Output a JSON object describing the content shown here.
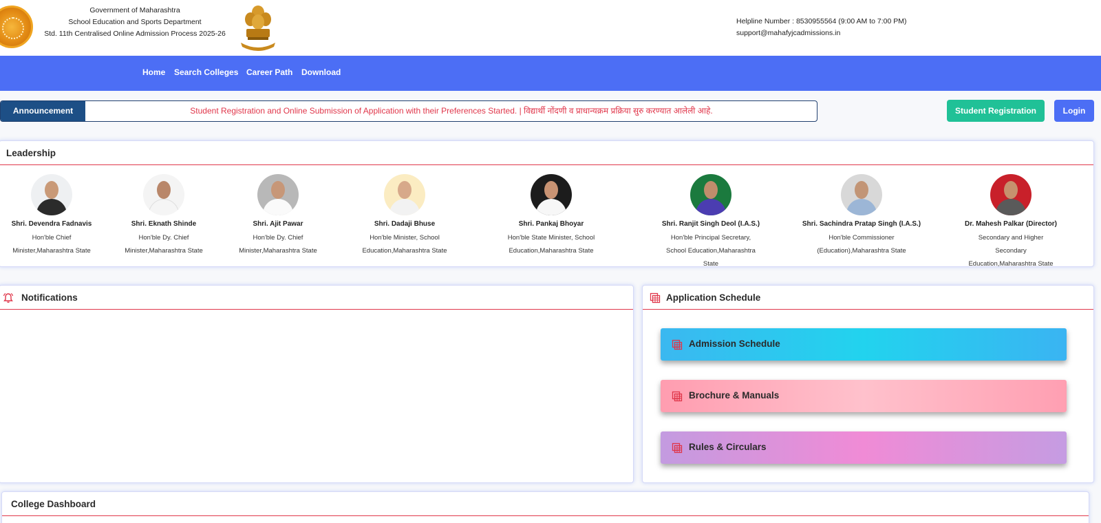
{
  "header": {
    "gov_line1": "Government of Maharashtra",
    "gov_line2": "School Education and Sports Department",
    "gov_line3": "Std. 11th Centralised Online Admission Process 2025-26",
    "helpline": "Helpline Number : 8530955564 (9:00 AM to 7:00 PM)",
    "support_email": "support@mahafyjcadmissions.in"
  },
  "nav": {
    "items": [
      "Home",
      "Search Colleges",
      "Career Path",
      "Download"
    ]
  },
  "announcement": {
    "label": "Announcement",
    "text": "Student Registration and Online Submission of Application with their Preferences Started. | विद्यार्थी नोंदणी व प्राधान्यक्रम प्रक्रिया सुरु करण्यात आलेली आहे."
  },
  "actions": {
    "register_label": "Student Registration",
    "login_label": "Login"
  },
  "leadership": {
    "title": "Leadership",
    "people": [
      {
        "name": "Shri. Devendra Fadnavis",
        "role": "Hon'ble Chief Minister,Maharashtra State"
      },
      {
        "name": "Shri. Eknath Shinde",
        "role": "Hon'ble Dy. Chief Minister,Maharashtra State"
      },
      {
        "name": "Shri. Ajit Pawar",
        "role": "Hon'ble Dy. Chief Minister,Maharashtra State"
      },
      {
        "name": "Shri. Dadaji Bhuse",
        "role": "Hon'ble Minister, School Education,Maharashtra State"
      },
      {
        "name": "Shri. Pankaj Bhoyar",
        "role": "Hon'ble State Minister, School Education,Maharashtra State"
      },
      {
        "name": "Shri. Ranjit Singh Deol (I.A.S.)",
        "role": "Hon'ble Principal Secretary, School Education,Maharashtra State"
      },
      {
        "name": "Shri. Sachindra Pratap Singh (I.A.S.)",
        "role": "Hon'ble Commissioner (Education),Maharashtra State"
      },
      {
        "name": "Dr. Mahesh Palkar (Director)",
        "role": "Secondary and Higher Secondary Education,Maharashtra State"
      }
    ]
  },
  "notifications": {
    "title": "Notifications"
  },
  "schedule": {
    "title": "Application Schedule",
    "buttons": [
      "Admission Schedule",
      "Brochure & Manuals",
      "Rules & Circulars"
    ]
  },
  "college_dashboard": {
    "title": "College Dashboard"
  },
  "colors": {
    "nav_bg": "#4c6ef5",
    "accent_red": "#e0364a",
    "register_green": "#20c197",
    "announcement_label_bg": "#1d4f86"
  }
}
